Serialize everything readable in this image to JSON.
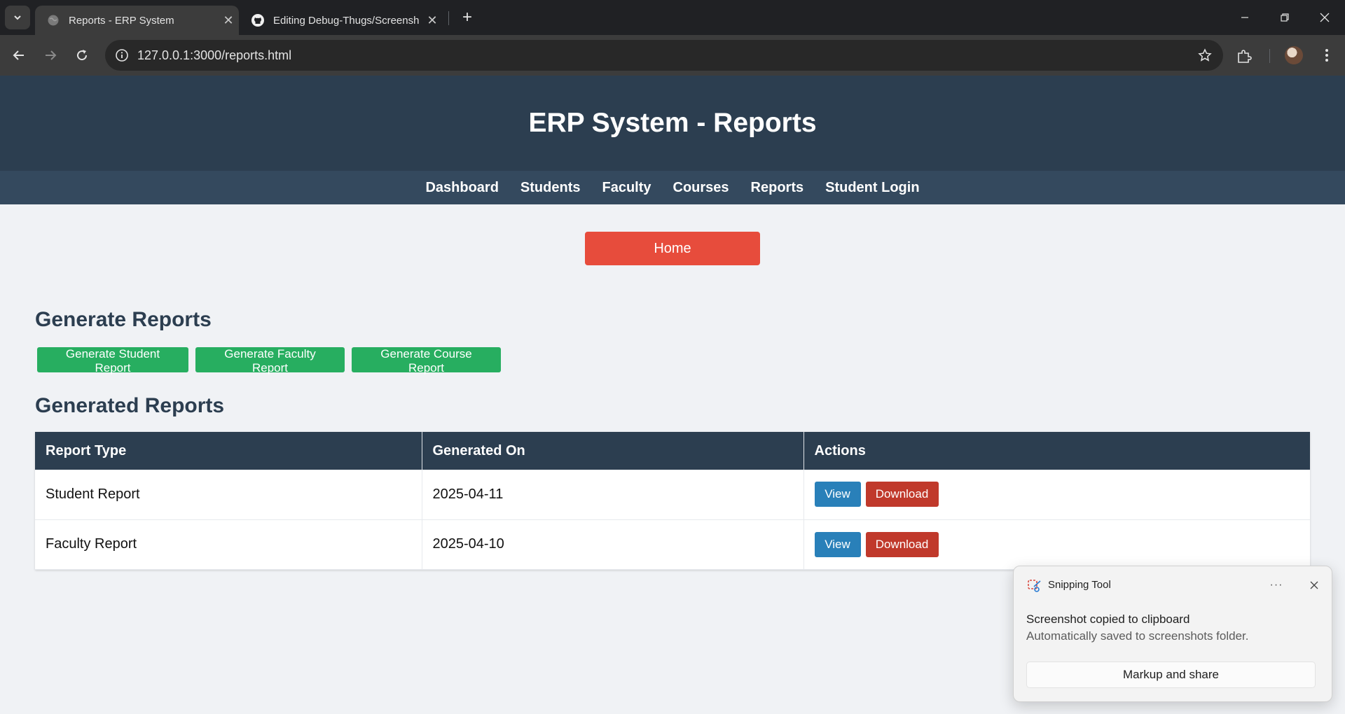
{
  "browser": {
    "tabs": [
      {
        "title": "Reports - ERP System",
        "icon": "globe-icon",
        "active": true
      },
      {
        "title": "Editing Debug-Thugs/Screensh",
        "icon": "github-icon",
        "active": false
      }
    ],
    "address": "127.0.0.1:3000/reports.html"
  },
  "site": {
    "title": "ERP System - Reports",
    "nav": [
      "Dashboard",
      "Students",
      "Faculty",
      "Courses",
      "Reports",
      "Student Login"
    ]
  },
  "home_button": "Home",
  "generate": {
    "heading": "Generate Reports",
    "buttons": [
      "Generate Student Report",
      "Generate Faculty Report",
      "Generate Course Report"
    ]
  },
  "generated": {
    "heading": "Generated Reports",
    "columns": [
      "Report Type",
      "Generated On",
      "Actions"
    ],
    "rows": [
      {
        "type": "Student Report",
        "date": "2025-04-11",
        "view": "View",
        "download": "Download"
      },
      {
        "type": "Faculty Report",
        "date": "2025-04-10",
        "view": "View",
        "download": "Download"
      }
    ]
  },
  "toast": {
    "app": "Snipping Tool",
    "message": "Screenshot copied to clipboard",
    "sub": "Automatically saved to screenshots folder.",
    "action": "Markup and share",
    "more": "···"
  },
  "colors": {
    "header": "#2c3e50",
    "nav": "#34495e",
    "home_button": "#e74c3c",
    "generate_button": "#27ae60",
    "view_button": "#2980b9",
    "download_button": "#c0392b"
  }
}
